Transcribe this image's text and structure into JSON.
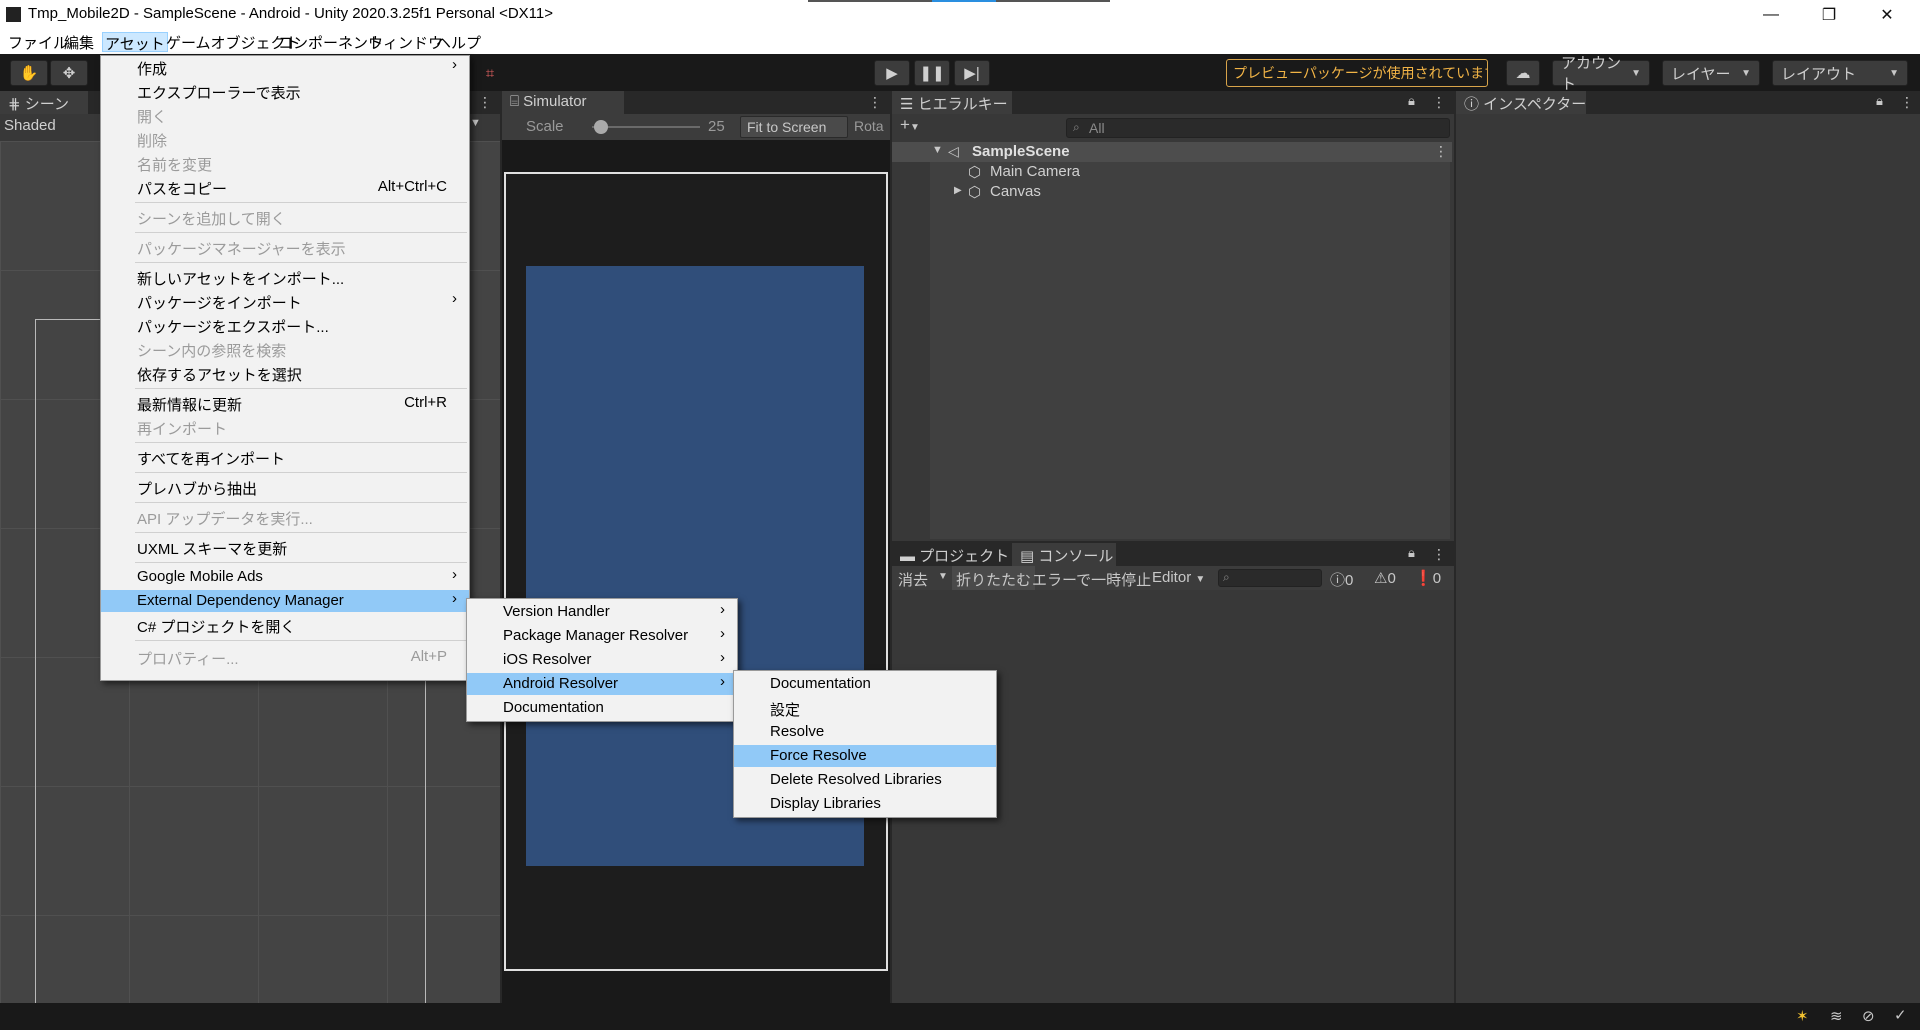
{
  "window": {
    "title": "Tmp_Mobile2D - SampleScene - Android - Unity 2020.3.25f1 Personal <DX11>",
    "controls": {
      "minimize": "—",
      "restore": "❐",
      "close": "✕"
    }
  },
  "menubar": [
    "ファイル",
    "編集",
    "アセット",
    "ゲームオブジェクト",
    "コンポーネント",
    "ウィンドウ",
    "ヘルプ"
  ],
  "toolbar": {
    "preview_badge": "プレビューパッケージが使用されています",
    "account": "アカウント",
    "layers": "レイヤー",
    "layout": "レイアウト"
  },
  "scene": {
    "tab": "シーン",
    "mode": "Shaded"
  },
  "simulator": {
    "tab": "Simulator",
    "scale_label": "Scale",
    "scale_value": "25",
    "fit_button": "Fit to Screen",
    "rotate_label": "Rota"
  },
  "hierarchy": {
    "tab": "ヒエラルキー",
    "search_placeholder": "All",
    "scene_name": "SampleScene",
    "items": [
      "Main Camera",
      "Canvas"
    ]
  },
  "inspector": {
    "tab": "インスペクター"
  },
  "project": {
    "tab": "プロジェクト"
  },
  "console": {
    "tab": "コンソール",
    "clear": "消去",
    "collapse": "折りたたむ",
    "error_pause": "エラーで一時停止",
    "editor": "Editor",
    "count_info": "0",
    "count_warn": "0",
    "count_error": "0"
  },
  "asset_menu": [
    {
      "label": "作成",
      "submenu": true
    },
    {
      "label": "エクスプローラーで表示"
    },
    {
      "label": "開く",
      "disabled": true
    },
    {
      "label": "削除",
      "disabled": true
    },
    {
      "label": "名前を変更",
      "disabled": true
    },
    {
      "label": "パスをコピー",
      "shortcut": "Alt+Ctrl+C"
    },
    {
      "label": "シーンを追加して開く",
      "disabled": true
    },
    {
      "label": "パッケージマネージャーを表示",
      "disabled": true
    },
    {
      "label": "新しいアセットをインポート..."
    },
    {
      "label": "パッケージをインポート",
      "submenu": true
    },
    {
      "label": "パッケージをエクスポート..."
    },
    {
      "label": "シーン内の参照を検索",
      "disabled": true
    },
    {
      "label": "依存するアセットを選択"
    },
    {
      "label": "最新情報に更新",
      "shortcut": "Ctrl+R"
    },
    {
      "label": "再インポート",
      "disabled": true
    },
    {
      "label": "すべてを再インポート"
    },
    {
      "label": "プレハブから抽出"
    },
    {
      "label": "API アップデータを実行...",
      "disabled": true
    },
    {
      "label": "UXML スキーマを更新"
    },
    {
      "label": "Google Mobile Ads",
      "submenu": true
    },
    {
      "label": "External Dependency Manager",
      "submenu": true,
      "highlighted": true
    },
    {
      "label": "C# プロジェクトを開く"
    },
    {
      "label": "プロパティー...",
      "shortcut": "Alt+P",
      "disabled": true
    }
  ],
  "edm_menu": [
    {
      "label": "Version Handler",
      "submenu": true
    },
    {
      "label": "Package Manager Resolver",
      "submenu": true
    },
    {
      "label": "iOS Resolver",
      "submenu": true
    },
    {
      "label": "Android Resolver",
      "submenu": true,
      "highlighted": true
    },
    {
      "label": "Documentation"
    }
  ],
  "android_menu": [
    {
      "label": "Documentation"
    },
    {
      "label": "設定"
    },
    {
      "label": "Resolve"
    },
    {
      "label": "Force Resolve",
      "highlighted": true
    },
    {
      "label": "Delete Resolved Libraries"
    },
    {
      "label": "Display Libraries"
    }
  ],
  "colors": {
    "accent_highlight": "#91c9f7",
    "preview_badge": "#f2b446",
    "device_screen": "#304e7a",
    "editor_bg": "#383838"
  }
}
